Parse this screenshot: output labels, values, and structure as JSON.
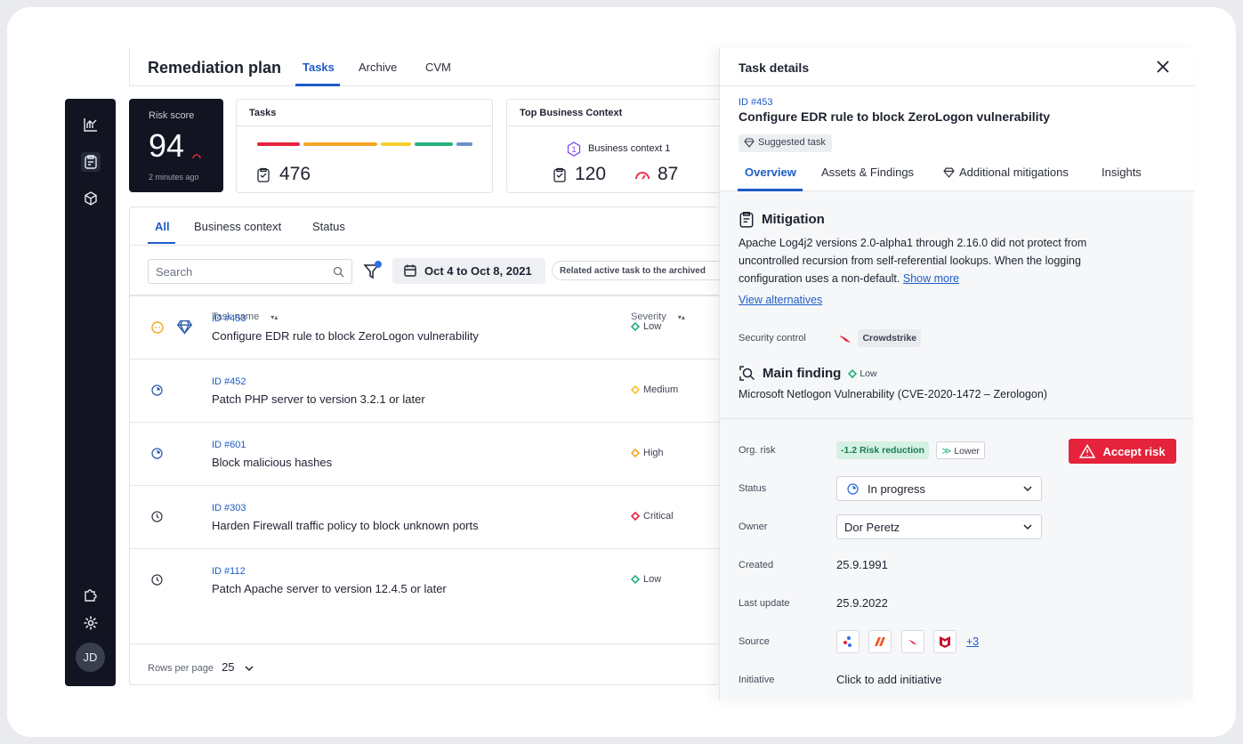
{
  "app": {
    "title": "Remediation plan",
    "tabs": [
      "Tasks",
      "Archive",
      "CVM"
    ]
  },
  "user": {
    "initials": "JD"
  },
  "risk_score": {
    "label": "Risk score",
    "value": "94",
    "updated": "2 minutes ago"
  },
  "tasks_card": {
    "label": "Tasks",
    "count": "476",
    "bar_colors": [
      "#e5233b",
      "#f5a524",
      "#f5cf2b",
      "#27b07b",
      "#6b8fc9"
    ]
  },
  "context_card": {
    "label": "Top Business Context",
    "context_name": "Business context 1",
    "context_num": "1",
    "tasks": "120",
    "risk": "87"
  },
  "filters": {
    "tabs": [
      "All",
      "Business context",
      "Status"
    ],
    "search_placeholder": "Search",
    "date_range": "Oct 4 to Oct 8, 2021",
    "chip": "Related active task to the archived"
  },
  "table": {
    "columns": [
      "Task name",
      "Severity"
    ],
    "rows": [
      {
        "id": "ID #453",
        "name": "Configure EDR rule to block ZeroLogon vulnerability",
        "severity": "Low",
        "sev_color": "#27b07b",
        "icon": "pending-icon"
      },
      {
        "id": "ID #452",
        "name": "Patch PHP server to version 3.2.1 or later",
        "severity": "Medium",
        "sev_color": "#f5c22b",
        "icon": "in-progress-icon"
      },
      {
        "id": "ID #601",
        "name": "Block malicious hashes",
        "severity": "High",
        "sev_color": "#f5a524",
        "icon": "in-progress-icon"
      },
      {
        "id": "ID #303",
        "name": "Harden Firewall traffic policy to block unknown ports",
        "severity": "Critical",
        "sev_color": "#e5233b",
        "icon": "clock-icon"
      },
      {
        "id": "ID #112",
        "name": "Patch Apache server to version 12.4.5 or later",
        "severity": "Low",
        "sev_color": "#27b07b",
        "icon": "clock-icon"
      }
    ],
    "rows_per_page_label": "Rows per page",
    "rows_per_page": "25"
  },
  "detail": {
    "header": "Task details",
    "id": "ID #453",
    "name": "Configure EDR rule to block ZeroLogon vulnerability",
    "badge": "Suggested task",
    "tabs": [
      "Overview",
      "Assets & Findings",
      "Additional mitigations",
      "Insights"
    ],
    "mitigation": {
      "title": "Mitigation",
      "text": "Apache Log4j2 versions 2.0-alpha1 through 2.16.0 did not protect from uncontrolled recursion from self-referential lookups. When the logging configuration uses a non-default.",
      "show_more": "Show more",
      "view_alternatives": "View alternatives"
    },
    "security_control": {
      "label": "Security control",
      "value": "Crowdstrike"
    },
    "main_finding": {
      "title": "Main finding",
      "severity": "Low",
      "text": "Microsoft Netlogon Vulnerability (CVE-2020-1472 – Zerologon)"
    },
    "fields": {
      "org_risk": {
        "label": "Org. risk",
        "reduction": "-1.2 Risk reduction",
        "level": "Lower"
      },
      "status": {
        "label": "Status",
        "value": "In progress"
      },
      "owner": {
        "label": "Owner",
        "value": "Dor Peretz"
      },
      "created": {
        "label": "Created",
        "value": "25.9.1991"
      },
      "last_update": {
        "label": "Last update",
        "value": "25.9.2022"
      },
      "source": {
        "label": "Source",
        "more": "+3"
      },
      "initiative": {
        "label": "Initiative",
        "value": "Click to add initiative"
      }
    },
    "accept_label": "Accept risk"
  }
}
